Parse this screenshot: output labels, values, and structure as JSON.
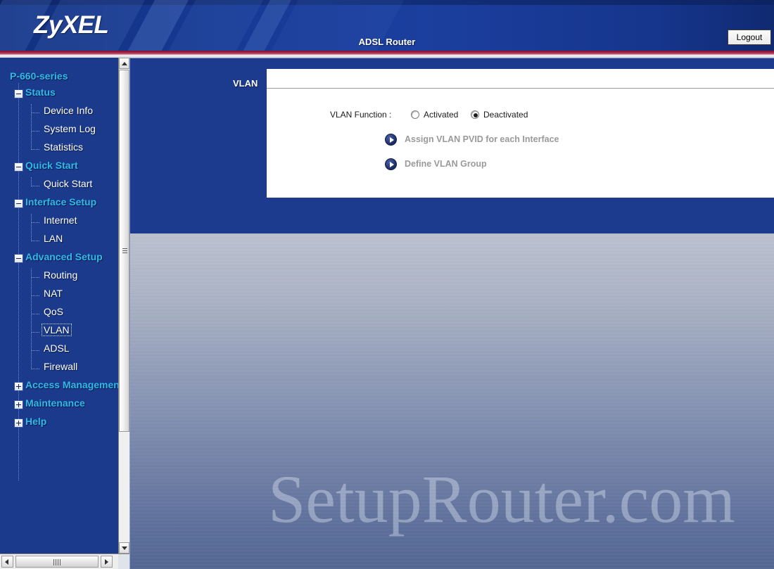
{
  "header": {
    "logo_text": "ZyXEL",
    "title": "ADSL Router",
    "logout_label": "Logout"
  },
  "sidebar": {
    "root_label": "P-660-series",
    "groups": [
      {
        "label": "Status",
        "expander": "minus",
        "children": [
          {
            "label": "Device Info"
          },
          {
            "label": "System Log"
          },
          {
            "label": "Statistics"
          }
        ]
      },
      {
        "label": "Quick Start",
        "expander": "minus",
        "children": [
          {
            "label": "Quick Start"
          }
        ]
      },
      {
        "label": "Interface Setup",
        "expander": "minus",
        "children": [
          {
            "label": "Internet"
          },
          {
            "label": "LAN"
          }
        ]
      },
      {
        "label": "Advanced Setup",
        "expander": "minus",
        "children": [
          {
            "label": "Routing"
          },
          {
            "label": "NAT"
          },
          {
            "label": "QoS"
          },
          {
            "label": "VLAN",
            "selected": true
          },
          {
            "label": "ADSL"
          },
          {
            "label": "Firewall"
          }
        ]
      },
      {
        "label": "Access Management",
        "expander": "plus",
        "children": []
      },
      {
        "label": "Maintenance",
        "expander": "plus",
        "children": []
      },
      {
        "label": "Help",
        "expander": "plus",
        "children": []
      }
    ]
  },
  "main": {
    "panel_label": "VLAN",
    "vlan_function_label": "VLAN Function :",
    "radio_activated_label": "Activated",
    "radio_deactivated_label": "Deactivated",
    "selected_radio": "Deactivated",
    "links": [
      {
        "label": "Assign VLAN PVID for each Interface"
      },
      {
        "label": "Define VLAN Group"
      }
    ],
    "watermark": "SetupRouter.com"
  },
  "colors": {
    "panel_blue": "#1c3b8f",
    "sidebar_blue": "#1b3a8c",
    "accent_cyan": "#2fb9ec",
    "stripe_maroon": "#a3274c",
    "link_gray": "#9a9a9a"
  }
}
